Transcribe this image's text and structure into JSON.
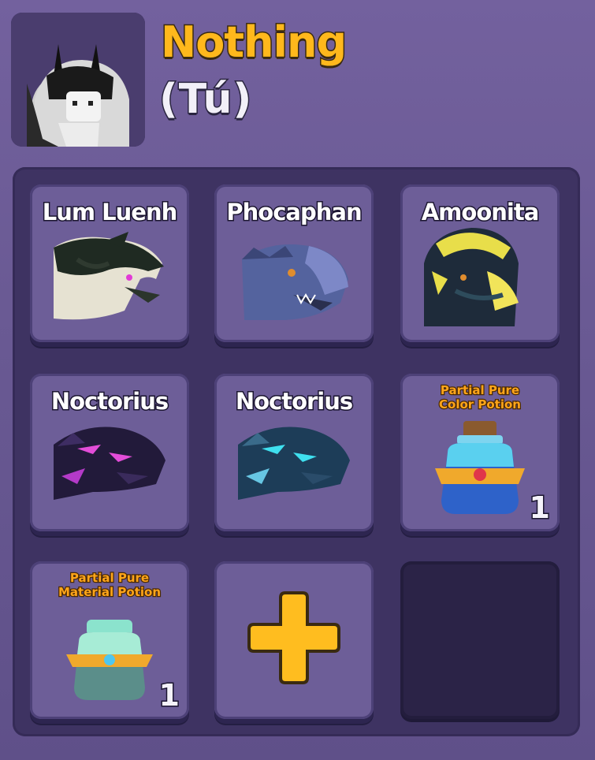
{
  "profile": {
    "username": "Nothing",
    "display_name": "(Tú)"
  },
  "inventory": {
    "slots": [
      {
        "label": "Lum Luenh",
        "kind": "dragon"
      },
      {
        "label": "Phocaphan",
        "kind": "dragon"
      },
      {
        "label": "Amoonita",
        "kind": "dragon"
      },
      {
        "label": "Noctorius",
        "kind": "dragon"
      },
      {
        "label": "Noctorius",
        "kind": "dragon"
      },
      {
        "label": "Partial Pure Color Potion",
        "kind": "potion",
        "quantity": "1"
      },
      {
        "label": "Partial Pure Material Potion",
        "kind": "potion",
        "quantity": "1"
      },
      {
        "label": "",
        "kind": "add-slot-button"
      },
      {
        "label": "",
        "kind": "empty"
      }
    ]
  },
  "colors": {
    "username": "#ffb81c",
    "panel": "#3e3362",
    "slot": "#6d5e98",
    "add_button": "#ffbd1f"
  }
}
